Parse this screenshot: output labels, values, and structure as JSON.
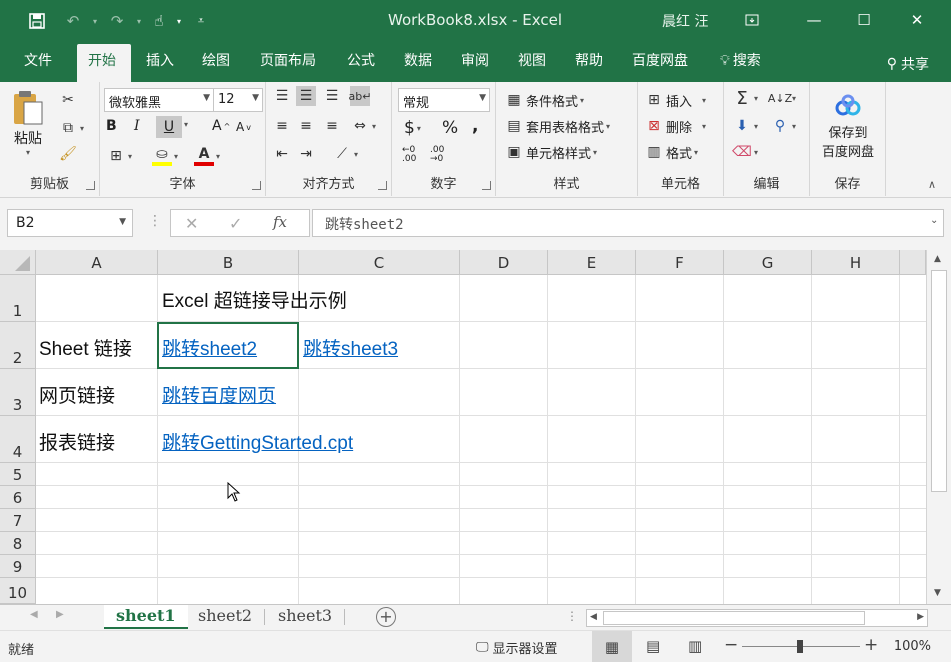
{
  "titlebar": {
    "title": "WorkBook8.xlsx  -  Excel",
    "user": "晨红 汪"
  },
  "tabs": [
    {
      "label": "文件"
    },
    {
      "label": "开始"
    },
    {
      "label": "插入"
    },
    {
      "label": "绘图"
    },
    {
      "label": "页面布局"
    },
    {
      "label": "公式"
    },
    {
      "label": "数据"
    },
    {
      "label": "审阅"
    },
    {
      "label": "视图"
    },
    {
      "label": "帮助"
    },
    {
      "label": "百度网盘"
    },
    {
      "label": "搜索"
    }
  ],
  "share_label": "共享",
  "ribbon": {
    "clipboard": {
      "paste": "粘贴",
      "label": "剪贴板"
    },
    "font": {
      "name": "微软雅黑",
      "size": "12",
      "bold": "B",
      "italic": "I",
      "underline": "U",
      "label": "字体"
    },
    "alignment": {
      "label": "对齐方式"
    },
    "number": {
      "format": "常规",
      "currency": "$",
      "percent": "%",
      "comma": ",",
      "label": "数字"
    },
    "styles": {
      "conditional": "条件格式",
      "table": "套用表格格式",
      "cell": "单元格样式",
      "label": "样式"
    },
    "cells": {
      "insert": "插入",
      "delete": "删除",
      "format": "格式",
      "label": "单元格"
    },
    "editing": {
      "label": "编辑"
    },
    "save": {
      "button": "保存到\n百度网盘",
      "line1": "保存到",
      "line2": "百度网盘",
      "label": "保存"
    }
  },
  "formulabar": {
    "namebox": "B2",
    "fx": "fx",
    "value": "跳转sheet2"
  },
  "columns": [
    "A",
    "B",
    "C",
    "D",
    "E",
    "F",
    "G",
    "H"
  ],
  "rows": [
    "1",
    "2",
    "3",
    "4",
    "5",
    "6",
    "7",
    "8",
    "9",
    "10"
  ],
  "cells": {
    "B1": "Excel 超链接导出示例",
    "A2": "Sheet 链接",
    "B2": "跳转sheet2",
    "C2": "跳转sheet3",
    "A3": "网页链接",
    "B3": "跳转百度网页",
    "A4": "报表链接",
    "B4": "跳转GettingStarted.cpt"
  },
  "sheets": [
    "sheet1",
    "sheet2",
    "sheet3"
  ],
  "active_sheet": "sheet1",
  "status": {
    "ready": "就绪",
    "display_settings": "显示器设置",
    "zoom": "100%"
  },
  "colors": {
    "accent": "#217346",
    "link": "#0563c1"
  }
}
